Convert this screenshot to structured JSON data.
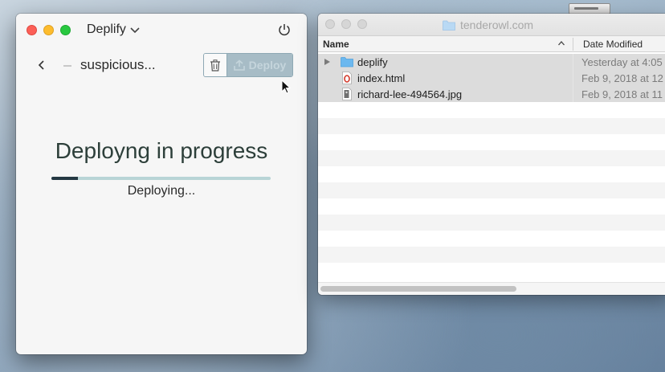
{
  "deplify_window": {
    "title": "Deplify",
    "site_name": "suspicious...",
    "deploy_label": "Deploy",
    "progress_title": "Deployng in progress",
    "progress_status": "Deploying...",
    "progress_fraction": 0.12,
    "accent_color": "#243843"
  },
  "finder_window": {
    "title": "tenderowl.com",
    "columns": {
      "name": "Name",
      "date": "Date Modified"
    },
    "rows": [
      {
        "name": "deplify",
        "date": "Yesterday at 4:05",
        "icon": "folder-icon",
        "selected": true
      },
      {
        "name": "index.html",
        "date": "Feb 9, 2018 at 12",
        "icon": "html-file-icon",
        "selected": true
      },
      {
        "name": "richard-lee-494564.jpg",
        "date": "Feb 9, 2018 at 11",
        "icon": "image-file-icon",
        "selected": true
      }
    ]
  }
}
